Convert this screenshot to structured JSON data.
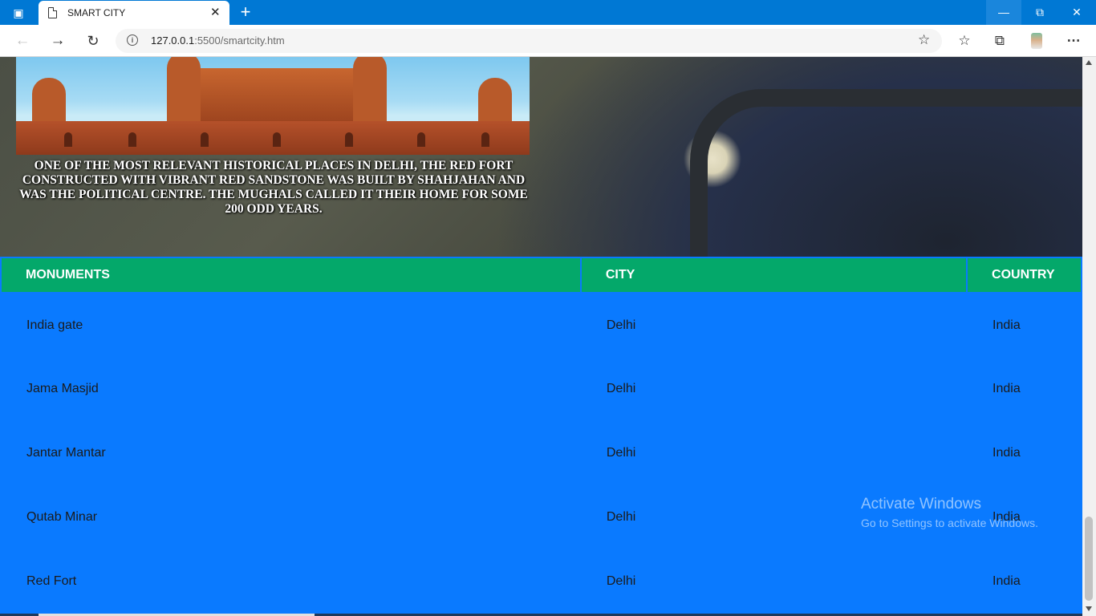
{
  "browser": {
    "tab_title": "SMART CITY",
    "new_tab_label": "+",
    "url_host": "127.0.0.1",
    "url_rest": ":5500/smartcity.htm"
  },
  "hero": {
    "caption": "ONE OF THE MOST RELEVANT HISTORICAL PLACES IN DELHI, THE RED FORT CONSTRUCTED WITH VIBRANT RED SANDSTONE WAS BUILT BY SHAHJAHAN AND WAS THE POLITICAL CENTRE. THE MUGHALS CALLED IT THEIR HOME FOR SOME 200 ODD YEARS."
  },
  "table": {
    "headers": [
      "MONUMENTS",
      "CITY",
      "COUNTRY"
    ],
    "rows": [
      [
        "India gate",
        "Delhi",
        "India"
      ],
      [
        "Jama Masjid",
        "Delhi",
        "India"
      ],
      [
        "Jantar Mantar",
        "Delhi",
        "India"
      ],
      [
        "Qutab Minar",
        "Delhi",
        "India"
      ],
      [
        "Red Fort",
        "Delhi",
        "India"
      ]
    ]
  },
  "watermark": {
    "title": "Activate Windows",
    "subtitle": "Go to Settings to activate Windows."
  },
  "colors": {
    "page_bg": "#0a7aff",
    "header_bg": "#04a86a",
    "titlebar": "#0078d4"
  },
  "icons": {
    "tab_actions": "tab-actions-icon",
    "page": "page-icon",
    "close": "close-icon",
    "back": "arrow-left-icon",
    "forward": "arrow-right-icon",
    "refresh": "refresh-icon",
    "info": "info-icon",
    "add_favorite": "star-plus-icon",
    "favorites": "favorites-icon",
    "collections": "collections-icon",
    "more": "more-icon"
  }
}
